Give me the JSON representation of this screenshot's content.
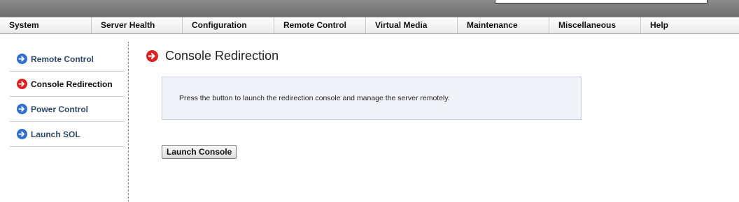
{
  "menu": {
    "items": [
      {
        "label": "System"
      },
      {
        "label": "Server Health"
      },
      {
        "label": "Configuration"
      },
      {
        "label": "Remote Control"
      },
      {
        "label": "Virtual Media"
      },
      {
        "label": "Maintenance"
      },
      {
        "label": "Miscellaneous"
      },
      {
        "label": "Help"
      }
    ]
  },
  "sidebar": {
    "items": [
      {
        "label": "Remote Control",
        "icon": "arrow-right-circle-icon",
        "color": "#2d6fd0"
      },
      {
        "label": "Console Redirection",
        "icon": "arrow-right-circle-icon",
        "color": "#e02020",
        "active": true
      },
      {
        "label": "Power Control",
        "icon": "arrow-right-circle-icon",
        "color": "#2d6fd0"
      },
      {
        "label": "Launch SOL",
        "icon": "arrow-right-circle-icon",
        "color": "#2d6fd0"
      }
    ]
  },
  "main": {
    "title": "Console Redirection",
    "title_icon_color": "#e02020",
    "info_text": "Press the button to launch the redirection console and manage the server remotely.",
    "launch_button_label": "Launch Console"
  }
}
